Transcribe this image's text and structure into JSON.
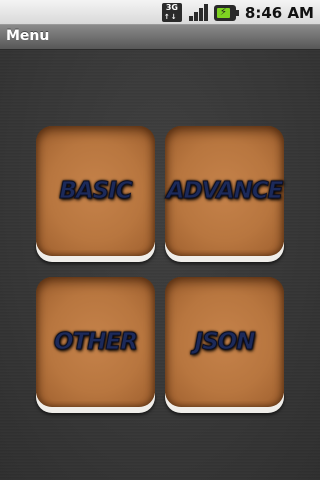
{
  "status_bar": {
    "network": "3G",
    "time": "8:46",
    "am_pm": "AM",
    "icons": [
      "3g-data-icon",
      "signal-icon",
      "battery-charging-icon"
    ]
  },
  "title_bar": {
    "title": "Menu"
  },
  "menu": {
    "items": [
      {
        "label": "BASIC"
      },
      {
        "label": "ADVANCE"
      },
      {
        "label": "OTHER"
      },
      {
        "label": "JSON"
      }
    ]
  },
  "colors": {
    "background": "#3b3b3b",
    "tile_face": "#b8763f",
    "tile_base": "#f0eeea",
    "label_text": "#1c2a5a",
    "title_bar": "#6e6e6e",
    "status_bar": "#e6e6e6"
  }
}
